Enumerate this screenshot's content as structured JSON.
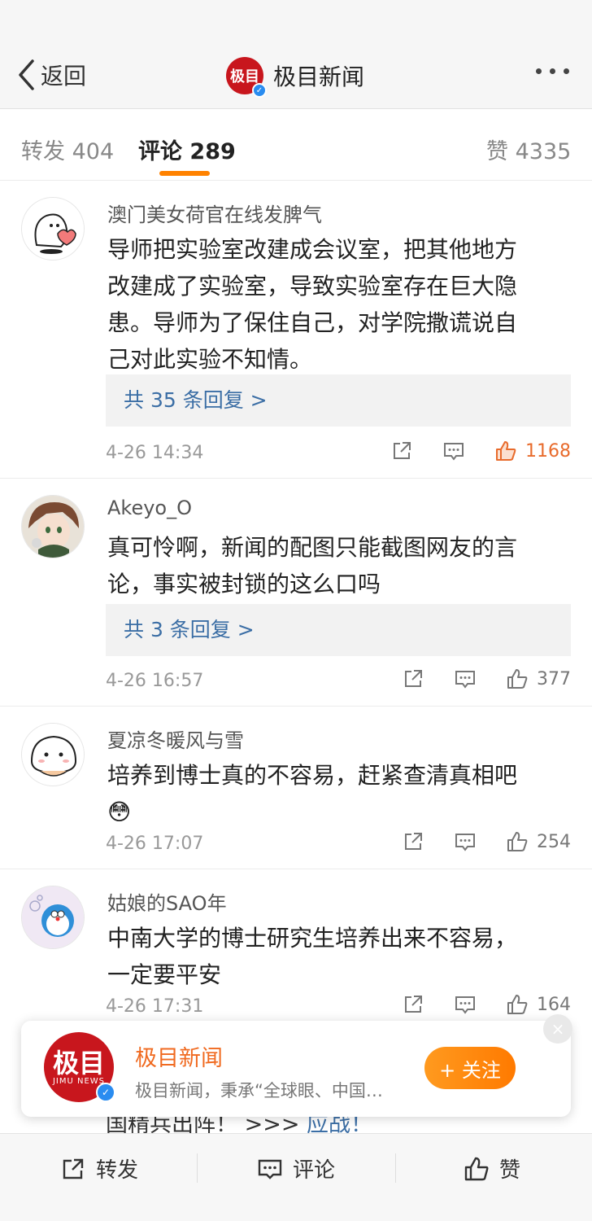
{
  "header": {
    "back_label": "返回",
    "title": "极目新闻",
    "logo_text": "极目"
  },
  "tabs": [
    {
      "label": "转发",
      "count": "404"
    },
    {
      "label": "评论",
      "count": "289"
    },
    {
      "label": "赞",
      "count": "4335"
    }
  ],
  "comments": [
    {
      "author": "澳门美女荷官在线发脾气",
      "text_lines": [
        "导师把实验室改建成会议室，把其他地方",
        "改建成了实验室，导致实验室存在巨大隐",
        "患。导师为了保住自己，对学院撒谎说自",
        "己对此实验不知情。"
      ],
      "replies": "共 35 条回复 >",
      "time": "4-26 14:34",
      "likes": "1168",
      "liked": true
    },
    {
      "author": "Akeyo_O",
      "text_lines": [
        "真可怜啊，新闻的配图只能截图网友的言",
        "论，事实被封锁的这么口吗"
      ],
      "replies": "共 3 条回复 >",
      "time": "4-26 16:57",
      "likes": "377",
      "liked": false
    },
    {
      "author": "夏凉冬暖风与雪",
      "text_lines": [
        "培养到博士真的不容易，赶紧查清真相吧"
      ],
      "emoji": "😳",
      "time": "4-26 17:07",
      "likes": "254",
      "liked": false
    },
    {
      "author": "姑娘的SAO年",
      "text_lines": [
        "中南大学的博士研究生培养出来不容易，",
        "一定要平安"
      ],
      "time": "4-26 17:31",
      "likes": "164",
      "liked": false
    }
  ],
  "banner": {
    "logo_text": "极目",
    "logo_sub": "JIMU NEWS",
    "name": "极目新闻",
    "desc": "极目新闻，秉承“全球眼、中国…",
    "follow_label": "+ 关注",
    "close": "×"
  },
  "peek": {
    "text": "国精兵出阵！ >>> ",
    "link": "应战！"
  },
  "bottombar": {
    "forward": "转发",
    "comment": "评论",
    "like": "赞"
  },
  "colors": {
    "accent": "#ff8200",
    "brand_red": "#c8161d",
    "link": "#3b6ea5",
    "like_hot": "#e86b2c"
  }
}
